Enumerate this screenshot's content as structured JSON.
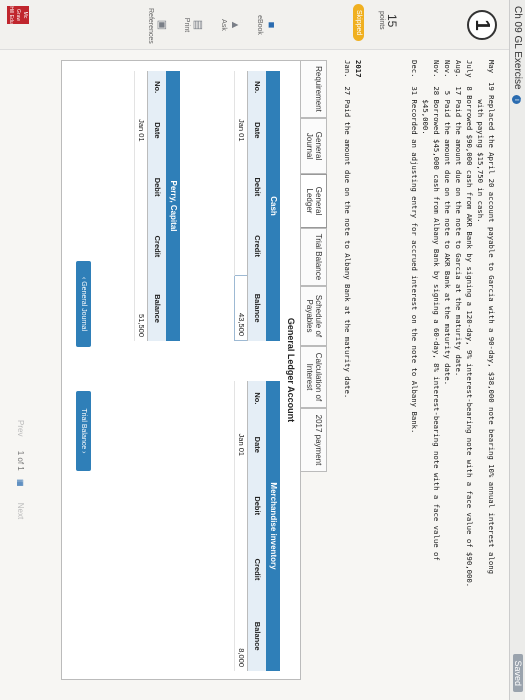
{
  "header": {
    "title": "Ch 09 GL Exercise",
    "info_glyph": "i",
    "save_label": "Saved"
  },
  "sidebar": {
    "question_number": "1",
    "points": "15",
    "points_label": "points",
    "status": "Skipped",
    "items": [
      {
        "label": "eBook",
        "icon": "book-icon"
      },
      {
        "label": "Ask",
        "icon": "megaphone-icon"
      },
      {
        "label": "Print",
        "icon": "printer-icon"
      },
      {
        "label": "References",
        "icon": "references-icon"
      }
    ],
    "brand": "Mc Graw Hill Edu"
  },
  "problem": {
    "lines": [
      "May  19 Replaced the April 20 account payable to Garcia with a 90-day, $38,000 note bearing 10% annual interest along",
      "         with paying $15,750 in cash.",
      "July  8 Borrowed $90,000 cash from AKR Bank by signing a 120-day, 9% interest-bearing note with a face value of $90,000.",
      "Aug.  17 Paid the amount due on the note to Garcia at the maturity date.",
      "Nov.   5 Paid the amount due on the note to AKR Bank at the maturity date.",
      "Nov.  28 Borrowed $45,000 cash from Albany Bank by signing a 60-day, 8% interest-bearing note with a face value of",
      "         $45,000.",
      "Dec.  31 Recorded an adjusting entry for accrued interest on the note to Albany Bank."
    ],
    "year": "2017",
    "year_line": "Jan.  27 Paid the amount due on the note to Albany Bank at the maturity date."
  },
  "tabs": [
    {
      "label": "Requirement",
      "active": false
    },
    {
      "label": "General Journal",
      "active": false
    },
    {
      "label": "General Ledger",
      "active": true
    },
    {
      "label": "Trial Balance",
      "active": false
    },
    {
      "label": "Schedule of Payables",
      "active": false
    },
    {
      "label": "Calculation of Interest",
      "active": false
    },
    {
      "label": "2017 payment",
      "active": false
    }
  ],
  "ledger": {
    "title": "General Ledger Account",
    "cash": {
      "title": "Cash",
      "columns": [
        "No.",
        "Date",
        "Debit",
        "Credit",
        "Balance"
      ],
      "rows": [
        {
          "no": "",
          "date": "Jan 01",
          "debit": "",
          "credit": "",
          "balance": "43,500"
        }
      ]
    },
    "merch": {
      "title": "Merchandise inventory",
      "columns": [
        "No.",
        "Date",
        "Debit",
        "Credit",
        "Balance"
      ],
      "rows": [
        {
          "no": "",
          "date": "Jan 01",
          "debit": "",
          "credit": "",
          "balance": "8,000"
        }
      ]
    },
    "capital": {
      "title": "Perry, Capital",
      "columns": [
        "No.",
        "Date",
        "Debit",
        "Credit",
        "Balance"
      ],
      "rows": [
        {
          "no": "",
          "date": "Jan 01",
          "debit": "",
          "credit": "",
          "balance": "51,500"
        }
      ]
    }
  },
  "nav": {
    "prev_label": "General Journal",
    "next_label": "Trial Balance"
  },
  "pager": {
    "prev": "Prev",
    "page": "1",
    "of": "of",
    "total": "1",
    "next": "Next"
  },
  "colors": {
    "accent": "#2f7fb8",
    "skipped": "#f0b020",
    "brand": "#c0262d"
  }
}
